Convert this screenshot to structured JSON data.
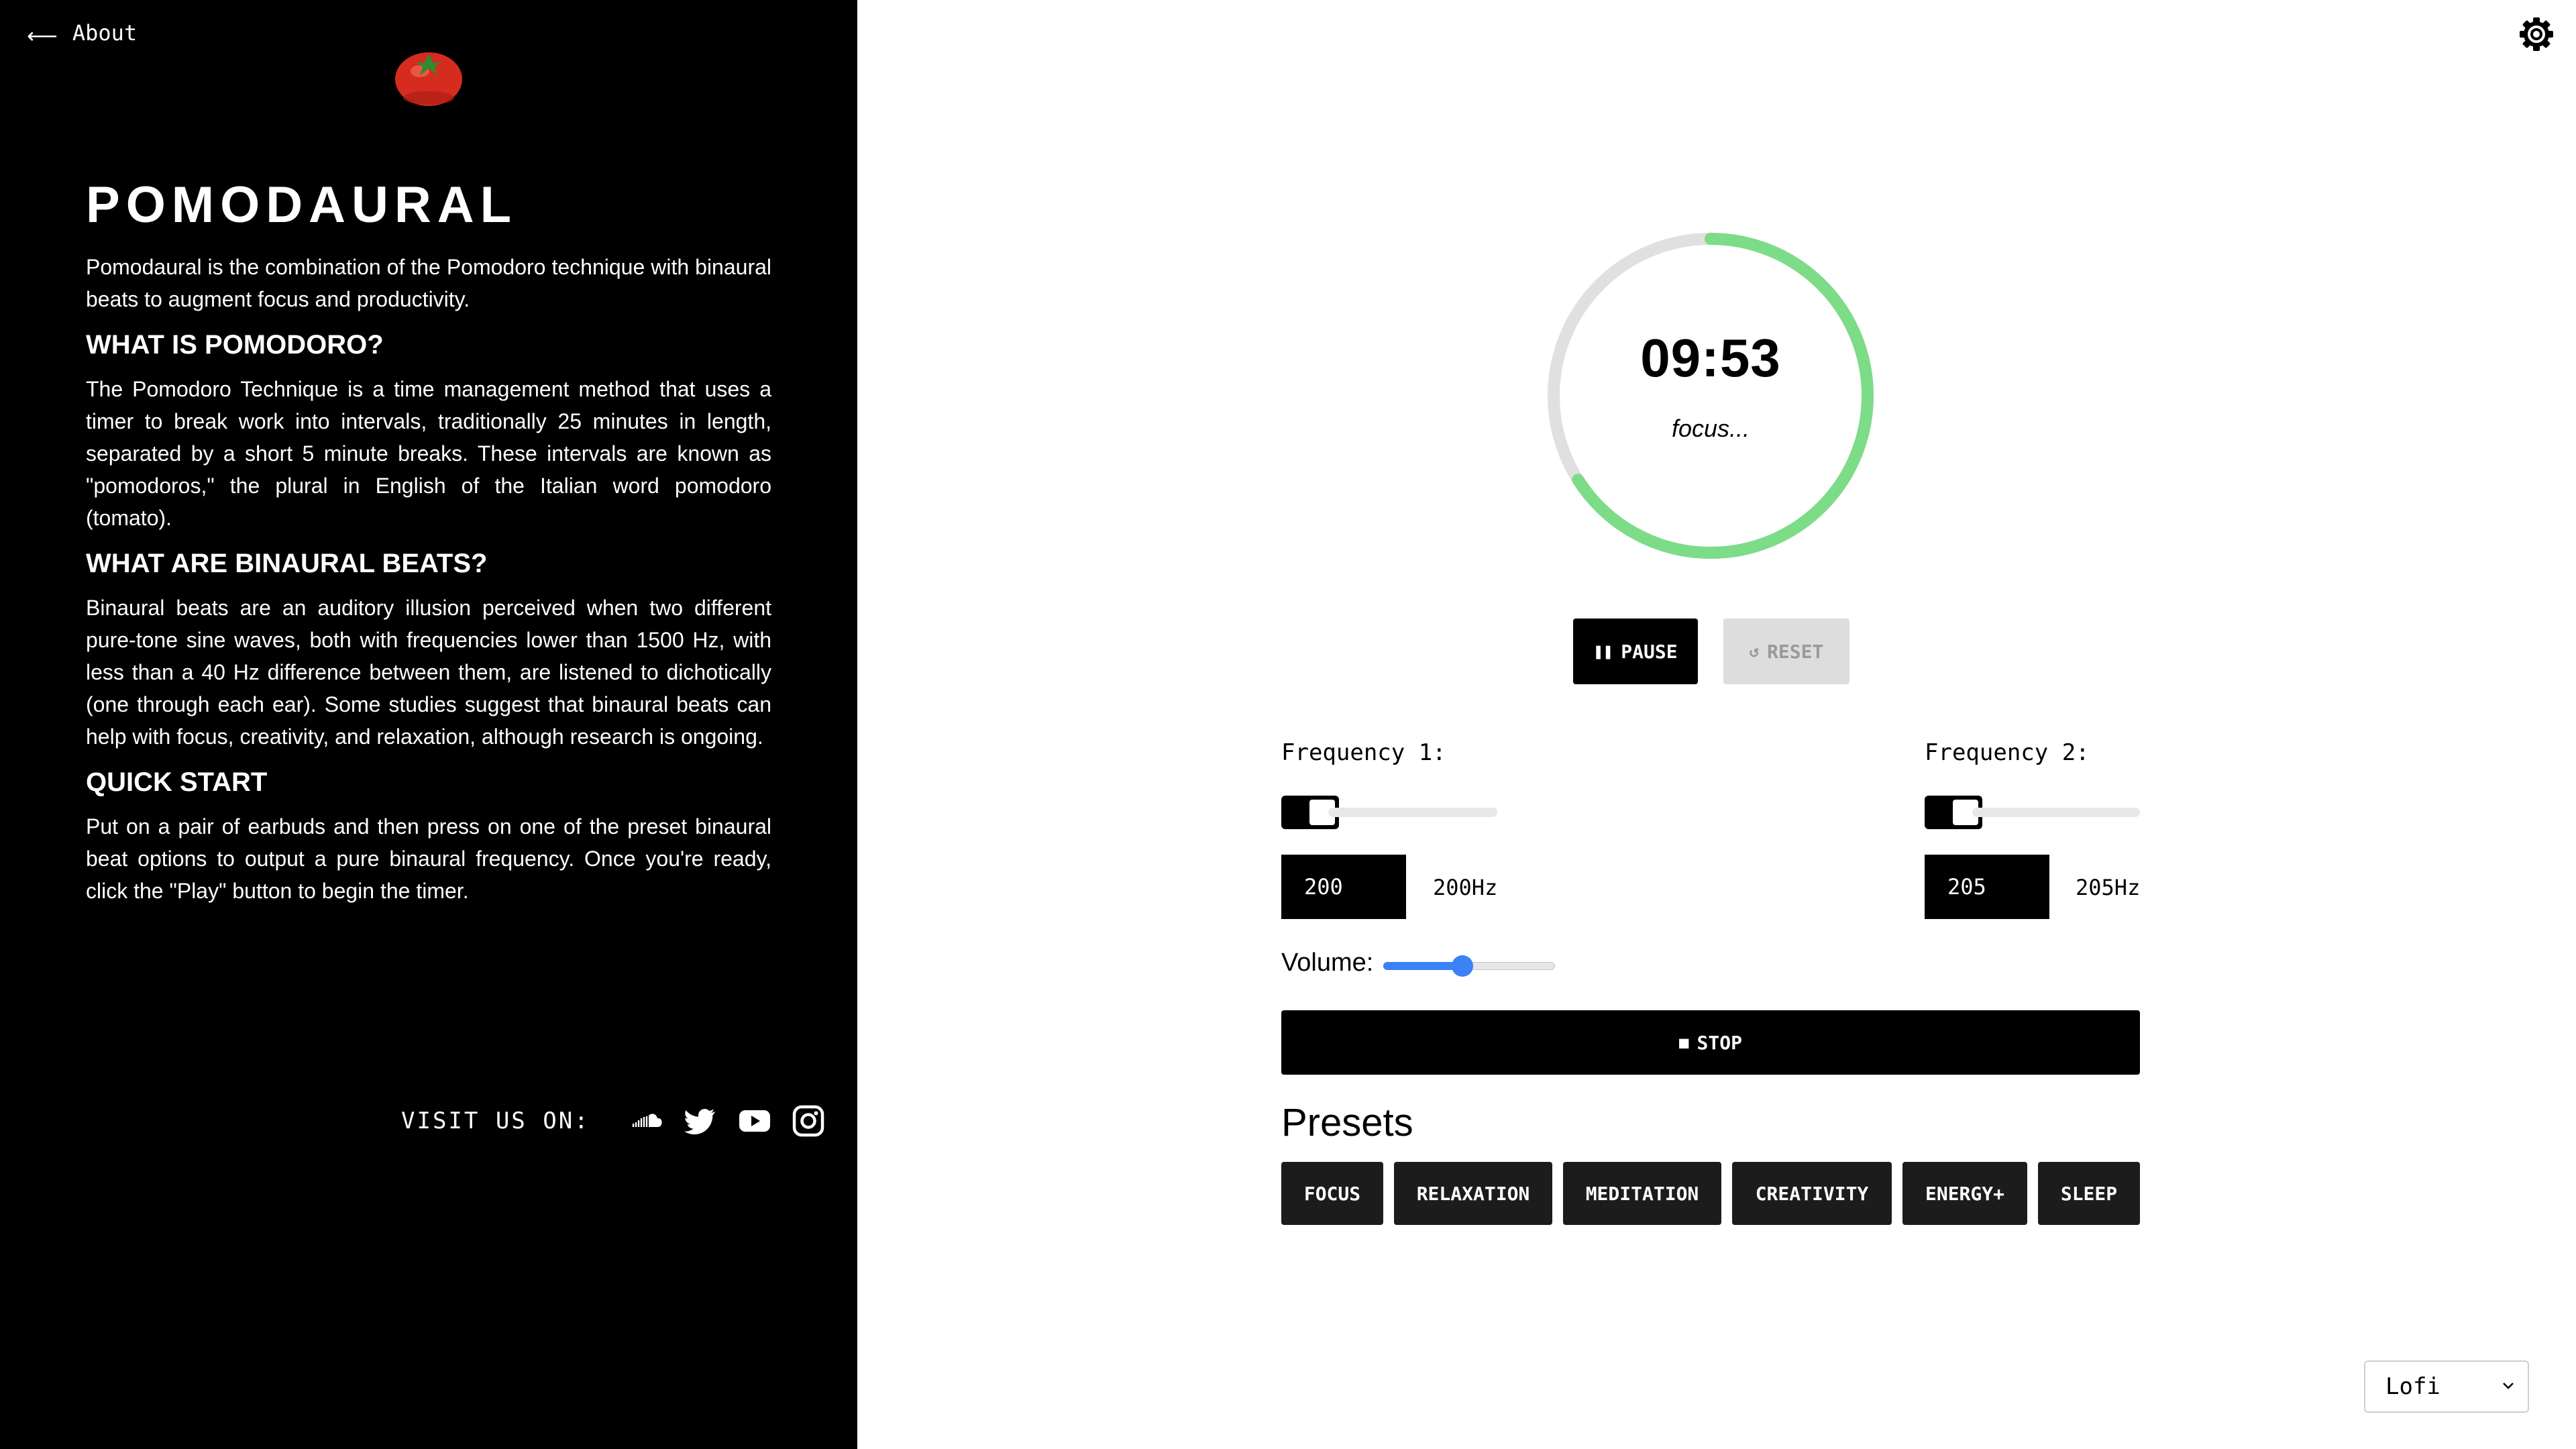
{
  "about_link": "About",
  "app_title": "POMODAURAL",
  "intro": "Pomodaural is the combination of the Pomodoro technique with binaural beats to augment focus and productivity.",
  "sections": [
    {
      "heading": "WHAT IS POMODORO?",
      "body": "The Pomodoro Technique is a time management method that uses a timer to break work into intervals, traditionally 25 minutes in length, separated by a short 5 minute breaks. These intervals are known as \"pomodoros,\" the plural in English of the Italian word pomodoro (tomato)."
    },
    {
      "heading": "WHAT ARE BINAURAL BEATS?",
      "body": "Binaural beats are an auditory illusion perceived when two different pure-tone sine waves, both with frequencies lower than 1500 Hz, with less than a 40 Hz difference between them, are listened to dichotically (one through each ear). Some studies suggest that binaural beats can help with focus, creativity, and relaxation, although research is ongoing."
    },
    {
      "heading": "QUICK START",
      "body": "Put on a pair of earbuds and then press on one of the preset binaural beat options to output a pure binaural frequency. Once you're ready, click the \"Play\" button to begin the timer."
    }
  ],
  "social": {
    "label": "VISIT US ON:",
    "icons": [
      "soundcloud-icon",
      "twitter-icon",
      "youtube-icon",
      "instagram-icon"
    ]
  },
  "timer": {
    "value": "09:53",
    "status": "focus...",
    "progress": 0.66,
    "ring_color": "#7ddc87",
    "track_color": "#e0e0e0"
  },
  "controls": {
    "pause_label": "PAUSE",
    "reset_label": "RESET",
    "stop_label": "STOP"
  },
  "frequency1": {
    "label": "Frequency 1:",
    "value": "200",
    "display": "200Hz"
  },
  "frequency2": {
    "label": "Frequency 2:",
    "value": "205",
    "display": "205Hz"
  },
  "volume": {
    "label": "Volume:",
    "level": 0.46,
    "color": "#3b82f6"
  },
  "presets": {
    "title": "Presets",
    "items": [
      "FOCUS",
      "RELAXATION",
      "MEDITATION",
      "CREATIVITY",
      "ENERGY+",
      "SLEEP"
    ]
  },
  "music_select": {
    "value": "Lofi"
  }
}
